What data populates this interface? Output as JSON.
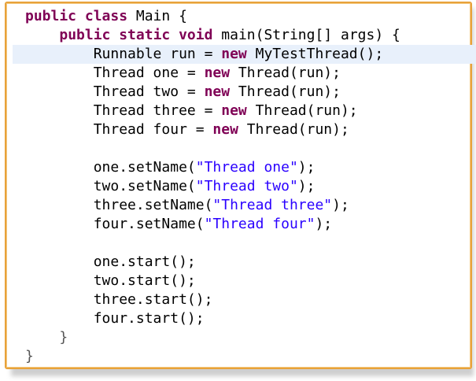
{
  "code": {
    "highlight_line": 3,
    "lines": [
      [
        {
          "t": "kw",
          "v": "public class"
        },
        {
          "t": "plain",
          "v": " Main {"
        }
      ],
      [
        {
          "t": "plain",
          "v": "    "
        },
        {
          "t": "kw",
          "v": "public static void"
        },
        {
          "t": "plain",
          "v": " main(String[] args) {"
        }
      ],
      [
        {
          "t": "plain",
          "v": "        Runnable run = "
        },
        {
          "t": "kw",
          "v": "new"
        },
        {
          "t": "plain",
          "v": " MyTestThread();"
        }
      ],
      [
        {
          "t": "plain",
          "v": "        Thread one = "
        },
        {
          "t": "kw",
          "v": "new"
        },
        {
          "t": "plain",
          "v": " Thread(run);"
        }
      ],
      [
        {
          "t": "plain",
          "v": "        Thread two = "
        },
        {
          "t": "kw",
          "v": "new"
        },
        {
          "t": "plain",
          "v": " Thread(run);"
        }
      ],
      [
        {
          "t": "plain",
          "v": "        Thread three = "
        },
        {
          "t": "kw",
          "v": "new"
        },
        {
          "t": "plain",
          "v": " Thread(run);"
        }
      ],
      [
        {
          "t": "plain",
          "v": "        Thread four = "
        },
        {
          "t": "kw",
          "v": "new"
        },
        {
          "t": "plain",
          "v": " Thread(run);"
        }
      ],
      [
        {
          "t": "plain",
          "v": ""
        }
      ],
      [
        {
          "t": "plain",
          "v": "        one.setName("
        },
        {
          "t": "str",
          "v": "\"Thread one\""
        },
        {
          "t": "plain",
          "v": ");"
        }
      ],
      [
        {
          "t": "plain",
          "v": "        two.setName("
        },
        {
          "t": "str",
          "v": "\"Thread two\""
        },
        {
          "t": "plain",
          "v": ");"
        }
      ],
      [
        {
          "t": "plain",
          "v": "        three.setName("
        },
        {
          "t": "str",
          "v": "\"Thread three\""
        },
        {
          "t": "plain",
          "v": ");"
        }
      ],
      [
        {
          "t": "plain",
          "v": "        four.setName("
        },
        {
          "t": "str",
          "v": "\"Thread four\""
        },
        {
          "t": "plain",
          "v": ");"
        }
      ],
      [
        {
          "t": "plain",
          "v": ""
        }
      ],
      [
        {
          "t": "plain",
          "v": "        one.start();"
        }
      ],
      [
        {
          "t": "plain",
          "v": "        two.start();"
        }
      ],
      [
        {
          "t": "plain",
          "v": "        three.start();"
        }
      ],
      [
        {
          "t": "plain",
          "v": "        four.start();"
        }
      ],
      [
        {
          "t": "br",
          "v": "    }"
        }
      ],
      [
        {
          "t": "br",
          "v": "}"
        }
      ]
    ]
  }
}
